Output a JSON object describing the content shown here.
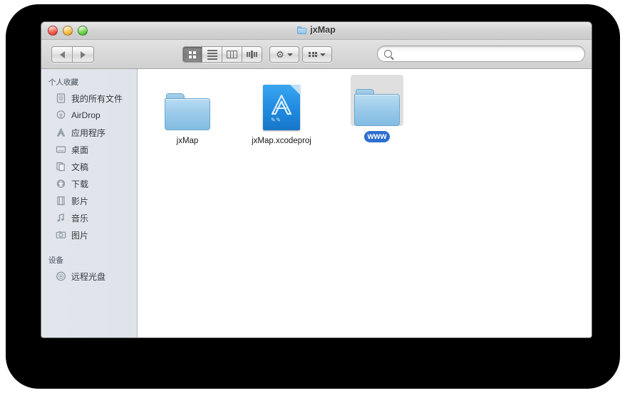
{
  "window": {
    "title": "jxMap",
    "title_icon": "folder-icon",
    "traffic_lights": [
      {
        "name": "close-button",
        "color": "#e8473f"
      },
      {
        "name": "minimize-button",
        "color": "#f0b030"
      },
      {
        "name": "zoom-button",
        "color": "#4fc334"
      }
    ]
  },
  "toolbar": {
    "back_label": "",
    "forward_label": "",
    "view_modes": [
      {
        "name": "icon-view",
        "icon": "grid-icon",
        "selected": true
      },
      {
        "name": "list-view",
        "icon": "list-icon",
        "selected": false
      },
      {
        "name": "column-view",
        "icon": "columns-icon",
        "selected": false
      },
      {
        "name": "coverflow-view",
        "icon": "coverflow-icon",
        "selected": false
      }
    ],
    "action_menu": {
      "icon": "gear-icon",
      "label": ""
    },
    "arrange_menu": {
      "icon": "arrange-grid-icon",
      "label": ""
    },
    "search": {
      "value": "",
      "placeholder": "",
      "icon": "search-icon"
    }
  },
  "sidebar": {
    "sections": [
      {
        "header": "个人收藏",
        "items": [
          {
            "label": "我的所有文件",
            "icon": "all-my-files-icon"
          },
          {
            "label": "AirDrop",
            "icon": "airdrop-icon"
          },
          {
            "label": "应用程序",
            "icon": "applications-icon"
          },
          {
            "label": "桌面",
            "icon": "desktop-icon"
          },
          {
            "label": "文稿",
            "icon": "documents-icon"
          },
          {
            "label": "下载",
            "icon": "downloads-icon"
          },
          {
            "label": "影片",
            "icon": "movies-icon"
          },
          {
            "label": "音乐",
            "icon": "music-icon"
          },
          {
            "label": "图片",
            "icon": "pictures-icon"
          }
        ]
      },
      {
        "header": "设备",
        "items": [
          {
            "label": "远程光盘",
            "icon": "remote-disc-icon"
          }
        ]
      }
    ]
  },
  "content": {
    "files": [
      {
        "name": "jxMap",
        "kind": "folder",
        "selected": false
      },
      {
        "name": "jxMap.xcodeproj",
        "kind": "xcode-project",
        "selected": false
      },
      {
        "name": "www",
        "kind": "folder",
        "selected": true
      }
    ]
  },
  "colors": {
    "selection_blue": "#2f6fd0",
    "folder_blue": "#9ccbea",
    "xcode_blue": "#1f8ae0",
    "sidebar_bg": "#e2e6ec",
    "toolbar_bg": "#d8d8d8"
  }
}
